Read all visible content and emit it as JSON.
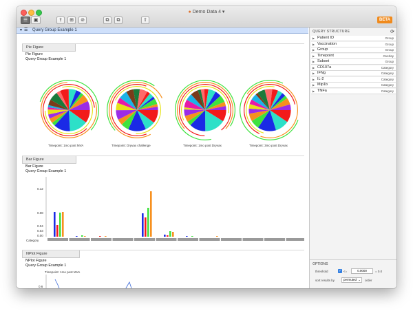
{
  "window": {
    "title": "Demo Data 4",
    "badge": "BETA"
  },
  "toolbar": {
    "buttons": [
      "sidebar-toggle",
      "list-view",
      "upload",
      "add-panel",
      "block",
      "copy-left",
      "copy-right",
      "share"
    ]
  },
  "query_bar": {
    "label": "Query Group Example 1"
  },
  "pie_section": {
    "tab": "Pie Figure",
    "title": "Pie Figure",
    "subtitle": "Query Group Example 1",
    "labels": [
      "Timepoint: 1mo post MVA",
      "Timepoint: Dryvax challenge",
      "Timepoint: 1mo post Dryvax",
      "Timepoint: 3mo post Dryvax"
    ]
  },
  "bar_section": {
    "tab": "Bar Figure",
    "title": "Bar Figure",
    "subtitle": "Query Group Example 1",
    "category_label": "Category",
    "yticks": [
      "0.12",
      "0.08",
      "0.04",
      "0.03",
      "0.00"
    ]
  },
  "nplot_section": {
    "tab": "NPlot Figure",
    "title": "NPlot Figure",
    "subtitle": "Query Group Example 1",
    "panel_title": "Timepoint: 1mo post MVA",
    "ytick": "0.6"
  },
  "sidebar": {
    "header": "QUERY STRUCTURE",
    "items": [
      {
        "name": "Patient ID",
        "kind": "Group"
      },
      {
        "name": "Vaccination",
        "kind": "Group"
      },
      {
        "name": "Group",
        "kind": "Group"
      },
      {
        "name": "Timepoint",
        "kind": "Overlay"
      },
      {
        "name": "Subset",
        "kind": "Group"
      },
      {
        "name": "CD107a",
        "kind": "Category"
      },
      {
        "name": "IFNg",
        "kind": "Category"
      },
      {
        "name": "IL-2",
        "kind": "Category"
      },
      {
        "name": "Mip1b",
        "kind": "Category"
      },
      {
        "name": "TNFa",
        "kind": "Category"
      }
    ],
    "options": {
      "header": "OPTIONS",
      "threshold_label": "threshold",
      "operator": "<=",
      "threshold_value": "0.0000",
      "suffix": "= 0.0",
      "sort_label": "sort results by",
      "sort_value": "permuted",
      "order_label": "order"
    }
  },
  "colors": {
    "accent": "#f08a1c",
    "selection": "#cfe0fb",
    "red": "#f21b1b",
    "green": "#3ee23e",
    "blue": "#1a2ae6",
    "orange": "#f7901e",
    "cyan": "#2de0c8"
  }
}
